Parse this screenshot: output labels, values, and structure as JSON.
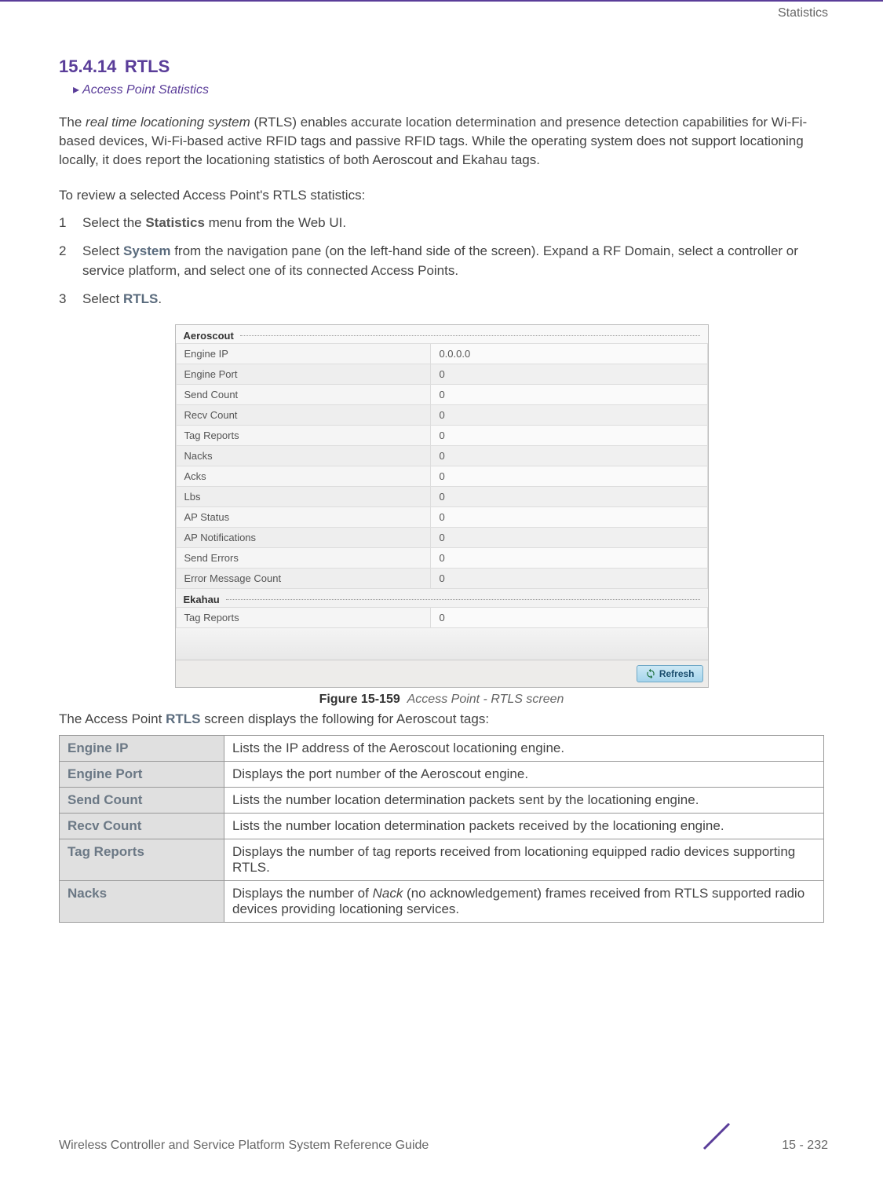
{
  "header": {
    "category": "Statistics"
  },
  "section": {
    "number": "15.4.14",
    "title": "RTLS"
  },
  "breadcrumb": {
    "arrow": "▸",
    "text": "Access Point Statistics"
  },
  "para1": {
    "pre": "The ",
    "ital": "real time locationing system",
    "post": " (RTLS) enables accurate location determination and presence detection capabilities for Wi-Fi-based devices, Wi-Fi-based active RFID tags and passive RFID tags. While the operating system does not support locationing locally, it does report the locationing statistics of both Aeroscout and Ekahau tags."
  },
  "stepsIntro": "To review a selected Access Point's RTLS statistics:",
  "steps": [
    {
      "num": "1",
      "pre": "Select the ",
      "bold": "Statistics",
      "post": " menu from the Web UI."
    },
    {
      "num": "2",
      "pre": "Select ",
      "bold": "System",
      "post": " from the navigation pane (on the left-hand side of the screen). Expand a RF Domain, select a controller or service platform, and select one of its connected Access Points."
    },
    {
      "num": "3",
      "pre": "Select ",
      "bold": "RTLS",
      "post": "."
    }
  ],
  "screenshot": {
    "group1": "Aeroscout",
    "rows1": [
      {
        "label": "Engine IP",
        "value": "0.0.0.0"
      },
      {
        "label": "Engine Port",
        "value": "0"
      },
      {
        "label": "Send Count",
        "value": "0"
      },
      {
        "label": "Recv Count",
        "value": "0"
      },
      {
        "label": "Tag Reports",
        "value": "0"
      },
      {
        "label": "Nacks",
        "value": "0"
      },
      {
        "label": "Acks",
        "value": "0"
      },
      {
        "label": "Lbs",
        "value": "0"
      },
      {
        "label": "AP Status",
        "value": "0"
      },
      {
        "label": "AP Notifications",
        "value": "0"
      },
      {
        "label": "Send Errors",
        "value": "0"
      },
      {
        "label": "Error Message Count",
        "value": "0"
      }
    ],
    "group2": "Ekahau",
    "rows2": [
      {
        "label": "Tag Reports",
        "value": "0"
      }
    ],
    "refresh": "Refresh"
  },
  "figure": {
    "num": "Figure 15-159",
    "text": "Access Point - RTLS screen"
  },
  "descAfter": {
    "pre": "The Access Point ",
    "bold": "RTLS",
    "post": " screen displays the following for Aeroscout tags:"
  },
  "propTable": [
    {
      "label": "Engine IP",
      "desc": "Lists the IP address of the Aeroscout locationing engine."
    },
    {
      "label": "Engine Port",
      "desc": "Displays the port number of the Aeroscout engine."
    },
    {
      "label": "Send Count",
      "desc": "Lists the number location determination packets sent by the locationing engine."
    },
    {
      "label": "Recv Count",
      "desc": "Lists the number location determination packets received by the locationing engine."
    },
    {
      "label": "Tag Reports",
      "desc": "Displays the number of tag reports received from locationing equipped radio devices supporting RTLS."
    },
    {
      "label": "Nacks",
      "descPre": "Displays the number of ",
      "descItal": "Nack",
      "descPost": " (no acknowledgement) frames received from RTLS supported radio devices providing locationing services."
    }
  ],
  "footer": {
    "left": "Wireless Controller and Service Platform System Reference Guide",
    "right": "15 - 232"
  }
}
